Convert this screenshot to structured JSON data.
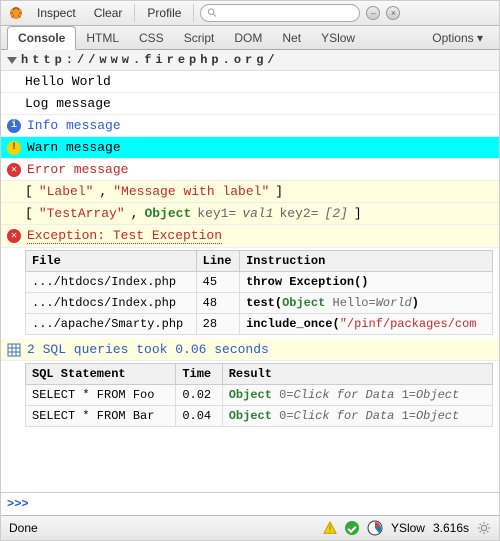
{
  "toolbar": {
    "inspect": "Inspect",
    "clear": "Clear",
    "profile": "Profile",
    "search_placeholder": ""
  },
  "tabs": {
    "console": "Console",
    "html": "HTML",
    "css": "CSS",
    "script": "Script",
    "dom": "DOM",
    "net": "Net",
    "yslow": "YSlow",
    "options": "Options ▾"
  },
  "url": "http://www.firephp.org/",
  "rows": {
    "hello": "Hello World",
    "log": "Log message",
    "info": "Info message",
    "warn": "Warn message",
    "error": "Error message",
    "label_open": "[ ",
    "label_1": "\"Label\"",
    "label_sep": ", ",
    "label_2": "\"Message with label\"",
    "label_close": " ]",
    "arr_1": "\"TestArray\"",
    "arr_obj": "Object",
    "arr_k1": " key1=",
    "arr_v1": "val1",
    "arr_k2": " key2=",
    "arr_v2": "[2]",
    "exception": "Exception: Test Exception"
  },
  "trace": {
    "headers": {
      "file": "File",
      "line": "Line",
      "instr": "Instruction"
    },
    "r1": {
      "file": ".../htdocs/Index.php",
      "line": "45",
      "instr": "throw Exception()"
    },
    "r2": {
      "file": ".../htdocs/Index.php",
      "line": "48",
      "call": "test(",
      "obj": "Object",
      "key": " Hello=",
      "val": "World",
      "close": ")"
    },
    "r3": {
      "file": ".../apache/Smarty.php",
      "line": "28",
      "call": "include_once(",
      "path": "\"/pinf/packages/com"
    }
  },
  "sql": {
    "summary": "2 SQL queries took 0.06 seconds",
    "headers": {
      "stmt": "SQL Statement",
      "time": "Time",
      "result": "Result"
    },
    "q1": {
      "stmt": "SELECT * FROM Foo",
      "time": "0.02"
    },
    "q2": {
      "stmt": "SELECT * FROM Bar",
      "time": "0.04"
    },
    "res_obj": "Object",
    "res_k0": " 0=",
    "res_v0": "Click for Data",
    "res_k1": " 1=",
    "res_v1": "Object"
  },
  "prompt": ">>>",
  "status": {
    "done": "Done",
    "yslow": "YSlow",
    "time": "3.616s"
  }
}
